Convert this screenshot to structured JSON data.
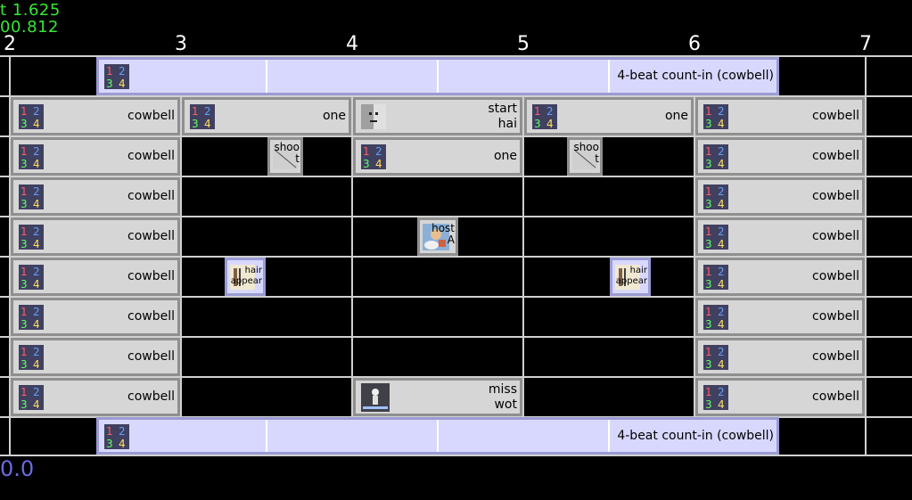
{
  "hud": {
    "line1": "t 1.625",
    "line2": "00.812"
  },
  "ticks": [
    "2",
    "3",
    "4",
    "5",
    "6",
    "7"
  ],
  "countin": {
    "label": "4-beat count-in (cowbell)"
  },
  "rows": [
    {
      "left": "cowbell",
      "right": "cowbell"
    },
    {
      "left": "cowbell",
      "right": "cowbell"
    },
    {
      "left": "cowbell",
      "right": "cowbell"
    },
    {
      "left": "cowbell",
      "right": "cowbell"
    },
    {
      "left": "cowbell",
      "right": "cowbell"
    },
    {
      "left": "cowbell",
      "right": "cowbell"
    },
    {
      "left": "cowbell",
      "right": "cowbell"
    },
    {
      "left": "cowbell",
      "right": "cowbell"
    }
  ],
  "events": {
    "one_a": "one",
    "start_hai": [
      "start",
      "hai"
    ],
    "one_b": "one",
    "one_c": "one",
    "shoot_a": [
      "shoo",
      "t"
    ],
    "shoot_b": [
      "shoo",
      "t"
    ],
    "host": [
      "host",
      "A"
    ],
    "hair_a": [
      "hair",
      "appear"
    ],
    "hair_b": [
      "hair",
      "appear"
    ],
    "miss": [
      "miss",
      "wot"
    ]
  },
  "bottom_value": "0.0",
  "colors": {
    "hud": "#37e637",
    "grid": "#d0d0d0",
    "block": "#d6d6d6",
    "lavender": "#d8d8ff",
    "bottom": "#6a6ae0"
  }
}
